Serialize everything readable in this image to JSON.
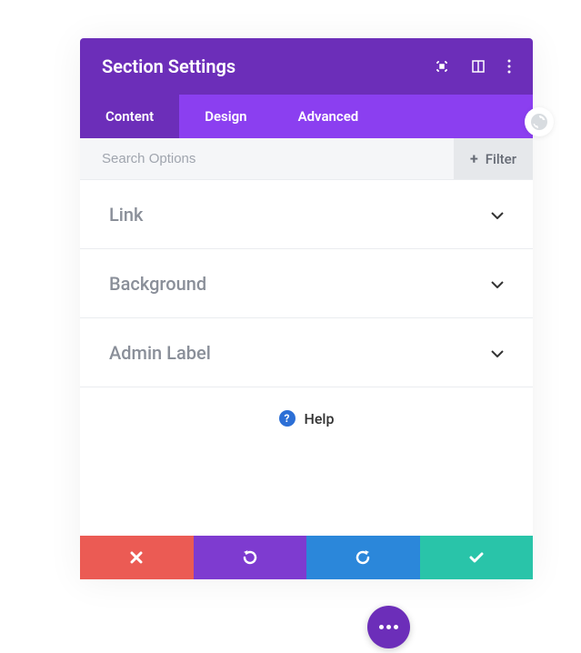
{
  "header": {
    "title": "Section Settings"
  },
  "tabs": {
    "content": "Content",
    "design": "Design",
    "advanced": "Advanced"
  },
  "search": {
    "placeholder": "Search Options",
    "filter_label": "Filter"
  },
  "options": [
    {
      "label": "Link"
    },
    {
      "label": "Background"
    },
    {
      "label": "Admin Label"
    }
  ],
  "help": {
    "label": "Help"
  }
}
